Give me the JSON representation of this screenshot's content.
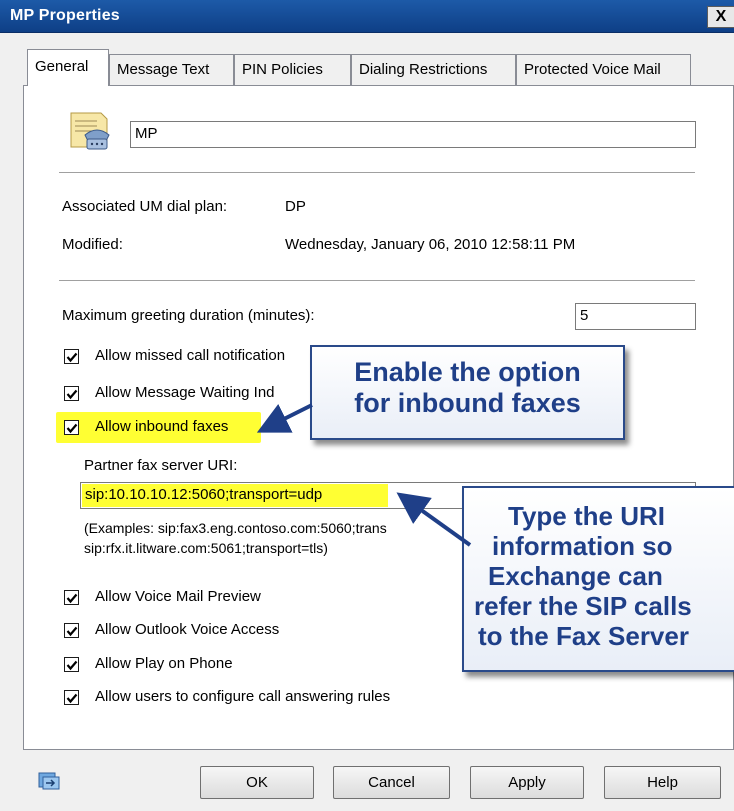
{
  "window": {
    "title": "MP Properties",
    "close_label": "X"
  },
  "tabs": [
    {
      "label": "General"
    },
    {
      "label": "Message Text"
    },
    {
      "label": "PIN Policies"
    },
    {
      "label": "Dialing Restrictions"
    },
    {
      "label": "Protected Voice Mail"
    }
  ],
  "general": {
    "name_value": "MP",
    "dial_plan_label": "Associated UM dial plan:",
    "dial_plan_value": "DP",
    "modified_label": "Modified:",
    "modified_value": "Wednesday, January 06, 2010 12:58:11 PM",
    "greeting_label": "Maximum greeting duration (minutes):",
    "greeting_value": "5",
    "missed_call_label": "Allow missed call notification",
    "mwi_label": "Allow Message Waiting Ind",
    "inbound_fax_label": "Allow inbound faxes",
    "partner_fax_label": "Partner fax server URI:",
    "partner_fax_value": "sip:10.10.10.12:5060;transport=udp",
    "examples_line1": "(Examples: sip:fax3.eng.contoso.com:5060;trans",
    "examples_line2": "sip:rfx.it.litware.com:5061;transport=tls)",
    "voice_mail_preview_label": "Allow Voice Mail Preview",
    "outlook_voice_label": "Allow Outlook Voice Access",
    "play_on_phone_label": "Allow Play on Phone",
    "call_answering_label": "Allow users to configure call answering rules",
    "checks": {
      "missed_call": true,
      "mwi": true,
      "inbound_fax": true,
      "voice_mail_preview": true,
      "outlook_voice": true,
      "play_on_phone": true,
      "call_answering": true
    }
  },
  "callouts": {
    "inbound": [
      "Enable the option",
      "for inbound faxes"
    ],
    "uri": [
      "Type the URI",
      "information so",
      "Exchange can",
      "refer the SIP calls",
      "to the Fax Server"
    ]
  },
  "buttons": {
    "ok": "OK",
    "cancel": "Cancel",
    "apply": "Apply",
    "help": "Help"
  },
  "colors": {
    "title_bar": "#1d5aa8",
    "highlight": "#ffff33",
    "callout_text": "#1f3f88",
    "arrow": "#1f3f88"
  }
}
